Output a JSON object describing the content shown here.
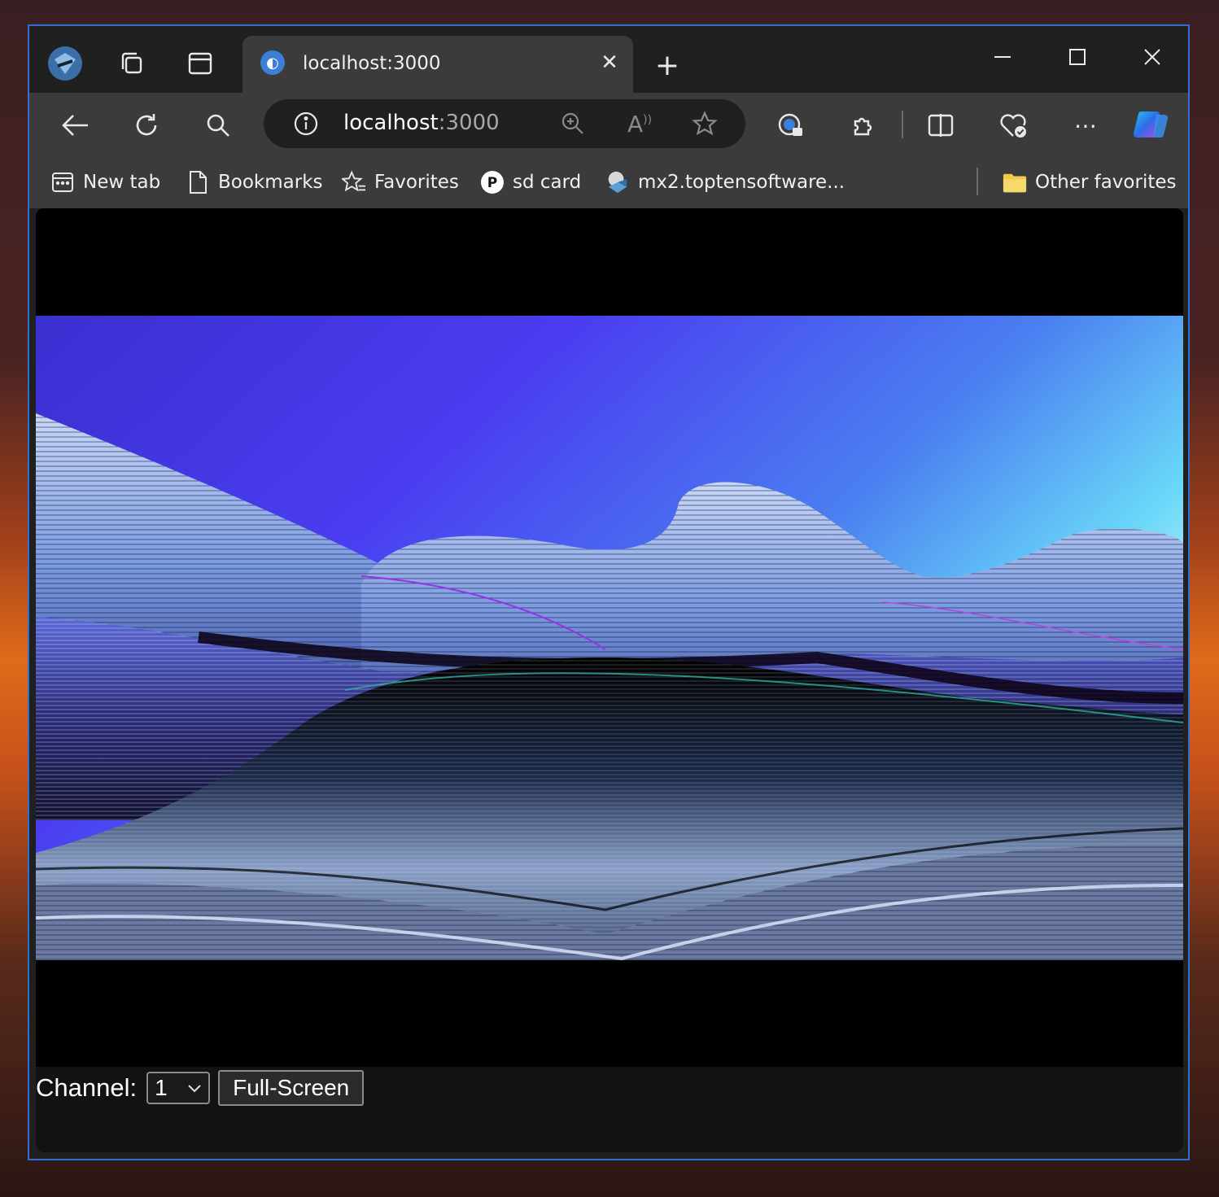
{
  "browser": {
    "tab": {
      "title": "localhost:3000"
    },
    "address": {
      "host": "localhost",
      "port": ":3000"
    },
    "favorites_bar": {
      "items": [
        {
          "label": "New tab",
          "icon": "new-tab-page-icon"
        },
        {
          "label": "Bookmarks",
          "icon": "document-icon"
        },
        {
          "label": "Favorites",
          "icon": "star-list-icon"
        },
        {
          "label": "sd card",
          "icon": "p-logo-icon"
        },
        {
          "label": "mx2.toptensoftware...",
          "icon": "site-favicon-icon"
        }
      ],
      "other_favorites": "Other favorites"
    }
  },
  "page": {
    "channel_label": "Channel:",
    "channel_value": "1",
    "fullscreen_label": "Full-Screen"
  },
  "colors": {
    "window_border": "#2f6fd0",
    "tab_bg": "#3b3b3b",
    "titlebar_bg": "#202020",
    "content_bg": "#121212"
  }
}
